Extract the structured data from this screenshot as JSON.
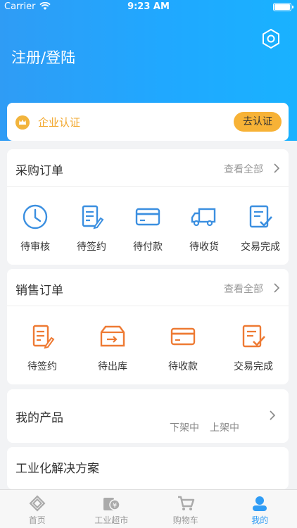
{
  "status_bar": {
    "carrier": "Carrier",
    "time": "9:23 AM"
  },
  "header": {
    "login_label": "注册/登陆"
  },
  "certification": {
    "label": "企业认证",
    "button": "去认证"
  },
  "purchase_orders": {
    "title": "采购订单",
    "view_all": "查看全部",
    "items": [
      {
        "label": "待审核",
        "icon": "clock-icon"
      },
      {
        "label": "待签约",
        "icon": "document-edit-icon"
      },
      {
        "label": "待付款",
        "icon": "card-icon"
      },
      {
        "label": "待收货",
        "icon": "truck-icon"
      },
      {
        "label": "交易完成",
        "icon": "checklist-icon"
      }
    ]
  },
  "sales_orders": {
    "title": "销售订单",
    "view_all": "查看全部",
    "items": [
      {
        "label": "待签约",
        "icon": "document-edit-icon"
      },
      {
        "label": "待出库",
        "icon": "box-out-icon"
      },
      {
        "label": "待收款",
        "icon": "card-icon"
      },
      {
        "label": "交易完成",
        "icon": "checklist-icon"
      }
    ]
  },
  "products": {
    "title": "我的产品",
    "off_shelf": "下架中",
    "on_shelf": "上架中"
  },
  "solutions": {
    "title": "工业化解决方案"
  },
  "tab_bar": {
    "tabs": [
      {
        "label": "首页",
        "icon": "home-icon"
      },
      {
        "label": "工业超市",
        "icon": "market-icon"
      },
      {
        "label": "购物车",
        "icon": "cart-icon"
      },
      {
        "label": "我的",
        "icon": "user-icon"
      }
    ],
    "active_index": 3
  },
  "colors": {
    "primary_blue": "#2f9cf5",
    "orange": "#ee7a33",
    "gold": "#f7b236"
  }
}
